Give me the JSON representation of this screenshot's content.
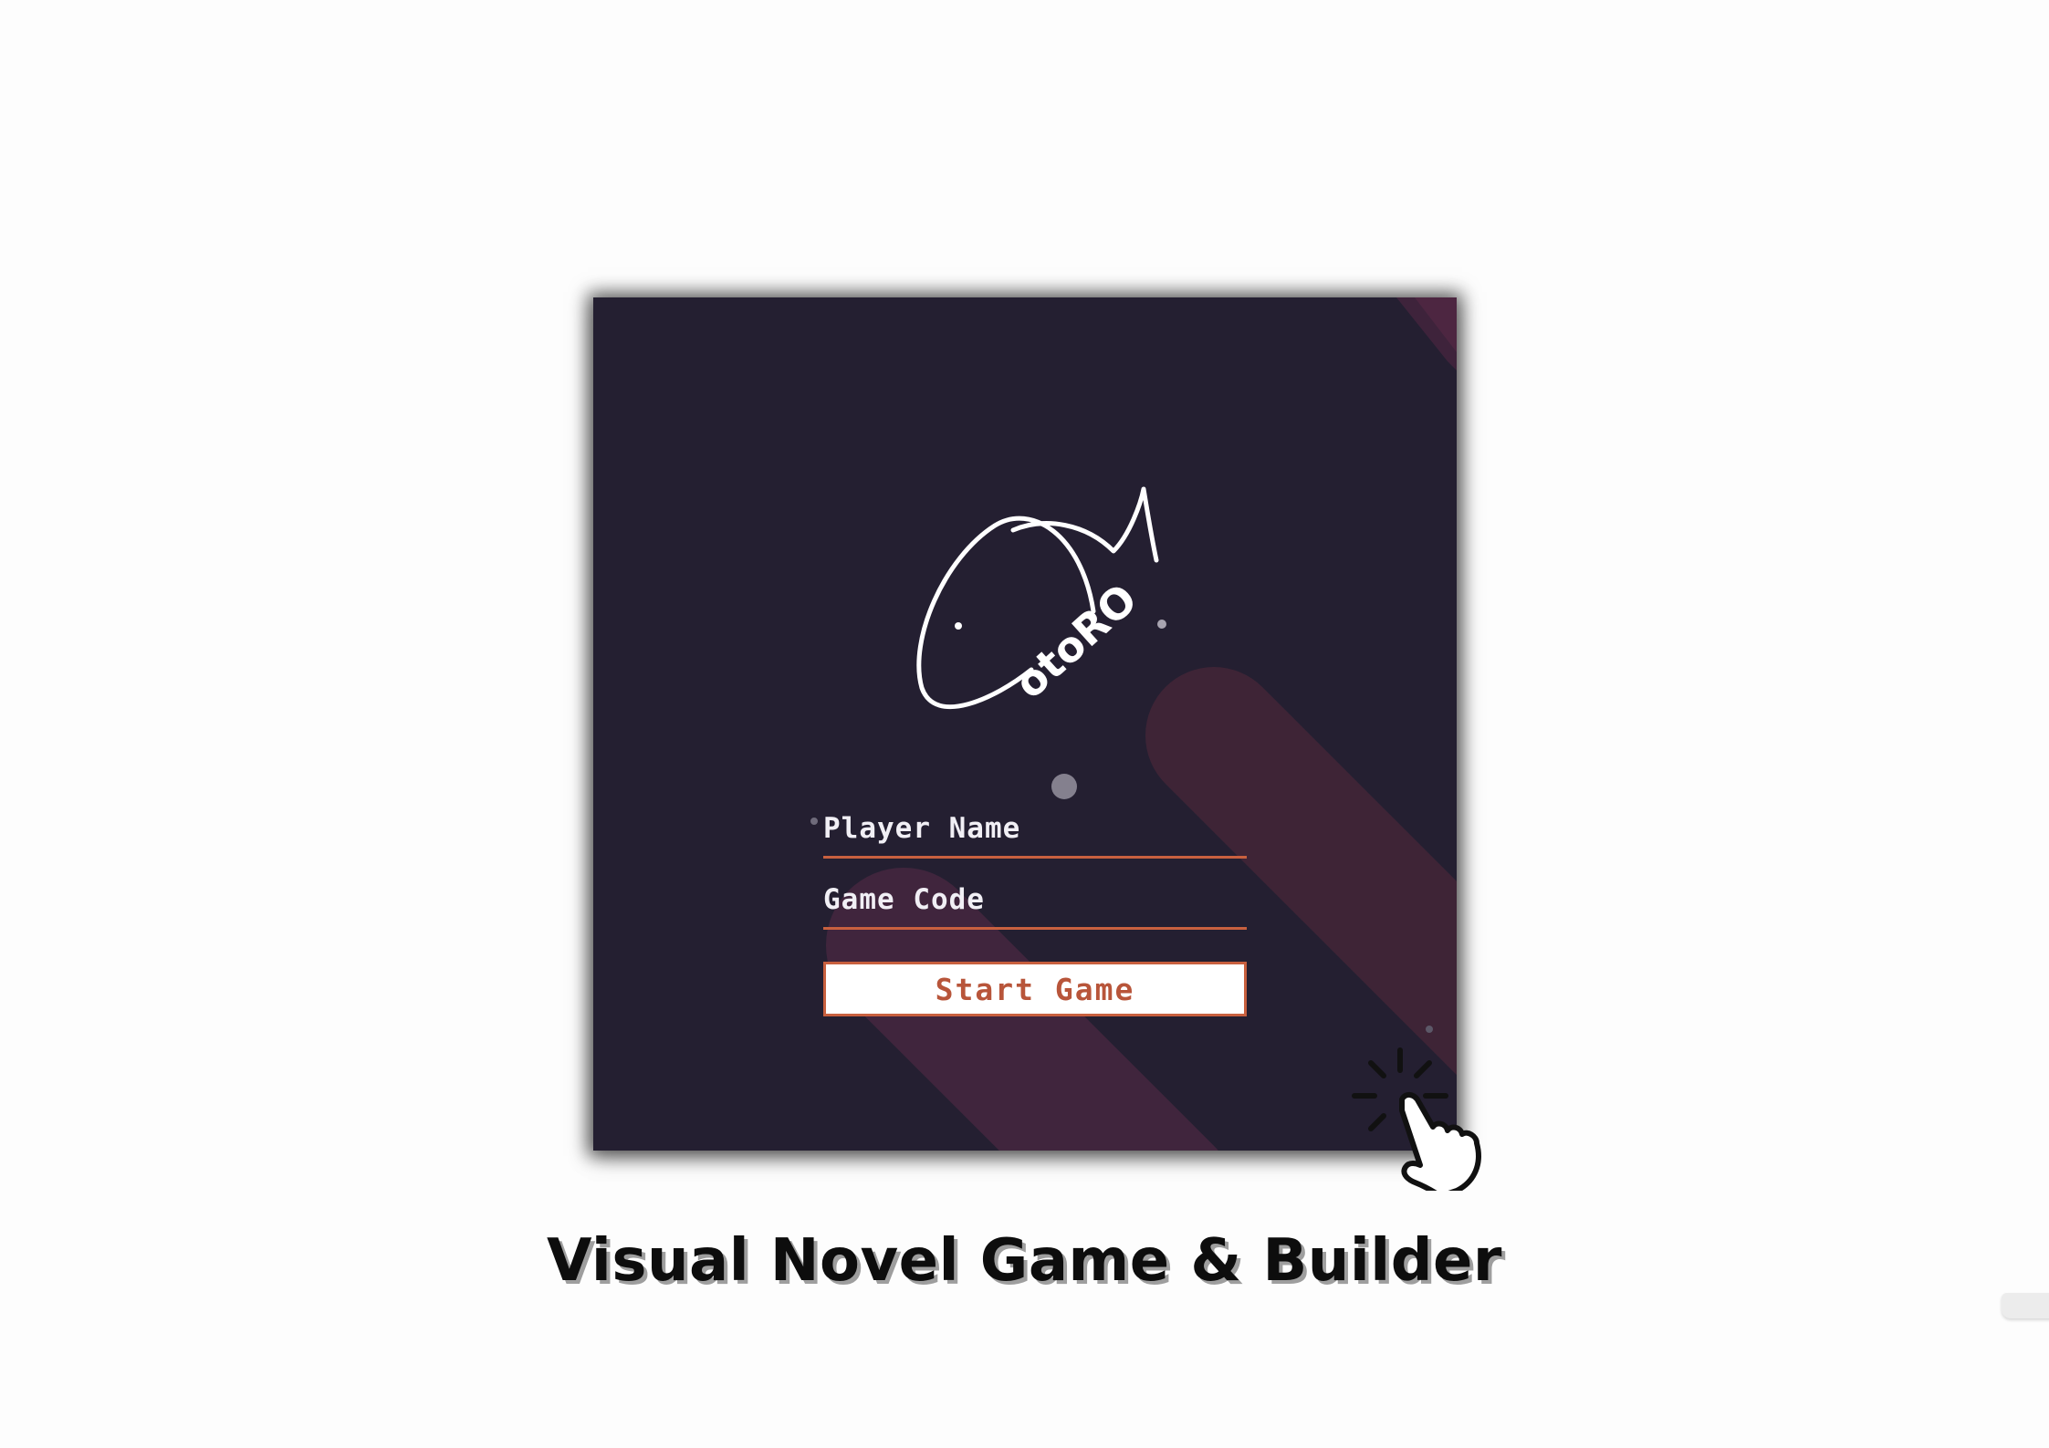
{
  "logo": {
    "text": "otoRO",
    "name": "otoro-logo"
  },
  "form": {
    "player_name_placeholder": "Player Name",
    "game_code_placeholder": "Game Code",
    "start_label": "Start Game"
  },
  "caption": "Visual Novel Game & Builder",
  "colors": {
    "panel_background": "#241f31",
    "stripe": "#5a2c47",
    "accent": "#c8603f",
    "button_text": "#b8553a",
    "caption_shadow": "#9e9e9e"
  },
  "icons": [
    "otoro-logo",
    "pointer-click-icon"
  ]
}
